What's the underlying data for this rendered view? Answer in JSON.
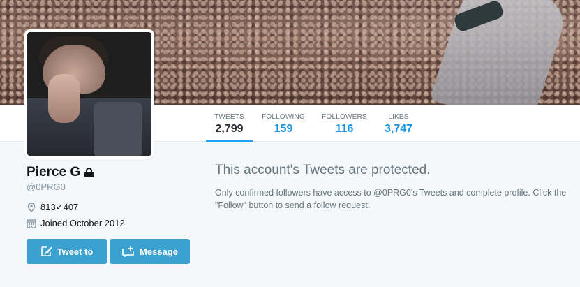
{
  "nav": {
    "tweets": {
      "label": "TWEETS",
      "value": "2,799"
    },
    "following": {
      "label": "FOLLOWING",
      "value": "159"
    },
    "followers": {
      "label": "FOLLOWERS",
      "value": "116"
    },
    "likes": {
      "label": "LIKES",
      "value": "3,747"
    }
  },
  "profile": {
    "name": "Pierce G",
    "handle": "@0PRG0",
    "location": "813✓407",
    "joined": "Joined October 2012"
  },
  "buttons": {
    "tweet_to": "Tweet to",
    "message": "Message"
  },
  "protected": {
    "title": "This account's Tweets are protected.",
    "body": "Only confirmed followers have access to @0PRG0's Tweets and complete profile. Click the \"Follow\" button to send a follow request."
  },
  "colors": {
    "accent": "#1da1f2",
    "button": "#3ba1d0",
    "link": "#1b95e0"
  },
  "icons": [
    "lock-icon",
    "location-pin-icon",
    "calendar-icon",
    "tweet-feather-icon",
    "message-icon"
  ]
}
